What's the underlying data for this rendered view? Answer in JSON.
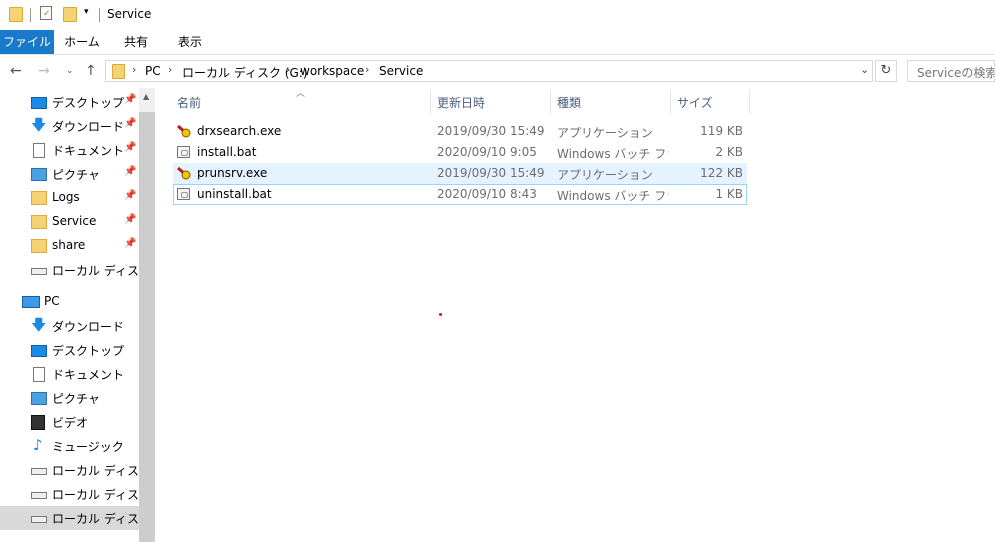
{
  "window": {
    "title": "Service"
  },
  "ribbon": {
    "tabs": [
      "ファイル",
      "ホーム",
      "共有",
      "表示"
    ]
  },
  "address": {
    "crumbs": [
      "PC",
      "ローカル ディスク (G:)",
      "workspace",
      "Service"
    ],
    "search_placeholder": "Serviceの検索"
  },
  "sidebar": {
    "quick_access": [
      {
        "label": "デスクトップ",
        "icon": "desktop-icon",
        "pinned": true
      },
      {
        "label": "ダウンロード",
        "icon": "download-icon",
        "pinned": true
      },
      {
        "label": "ドキュメント",
        "icon": "document-icon",
        "pinned": true
      },
      {
        "label": "ピクチャ",
        "icon": "pictures-icon",
        "pinned": true
      },
      {
        "label": "Logs",
        "icon": "folder-icon",
        "pinned": true
      },
      {
        "label": "Service",
        "icon": "folder-icon",
        "pinned": true
      },
      {
        "label": "share",
        "icon": "folder-icon",
        "pinned": true
      },
      {
        "label": "ローカル ディスク (F:",
        "icon": "drive-icon",
        "pinned": false
      }
    ],
    "pc_label": "PC",
    "pc_items": [
      {
        "label": "ダウンロード",
        "icon": "download-icon"
      },
      {
        "label": "デスクトップ",
        "icon": "desktop-icon"
      },
      {
        "label": "ドキュメント",
        "icon": "document-icon"
      },
      {
        "label": "ピクチャ",
        "icon": "pictures-icon"
      },
      {
        "label": "ビデオ",
        "icon": "video-icon"
      },
      {
        "label": "ミュージック",
        "icon": "music-icon"
      },
      {
        "label": "ローカル ディスク (C",
        "icon": "drive-icon"
      },
      {
        "label": "ローカル ディスク (F:",
        "icon": "drive-icon"
      },
      {
        "label": "ローカル ディスク (G",
        "icon": "drive-icon"
      }
    ]
  },
  "filelist": {
    "columns": [
      "名前",
      "更新日時",
      "種類",
      "サイズ"
    ],
    "files": [
      {
        "name": "drxsearch.exe",
        "date": "2019/09/30 15:49",
        "type": "アプリケーション",
        "size": "119 KB",
        "icon": "exe-icon"
      },
      {
        "name": "install.bat",
        "date": "2020/09/10 9:05",
        "type": "Windows バッチ ファ...",
        "size": "2 KB",
        "icon": "bat-icon"
      },
      {
        "name": "prunsrv.exe",
        "date": "2019/09/30 15:49",
        "type": "アプリケーション",
        "size": "122 KB",
        "icon": "exe-icon"
      },
      {
        "name": "uninstall.bat",
        "date": "2020/09/10 8:43",
        "type": "Windows バッチ ファ...",
        "size": "1 KB",
        "icon": "bat-icon"
      }
    ]
  },
  "colors": {
    "accent": "#1979ca",
    "hover_row": "#e5f3ff",
    "selected_nav": "#d9d9d9"
  }
}
